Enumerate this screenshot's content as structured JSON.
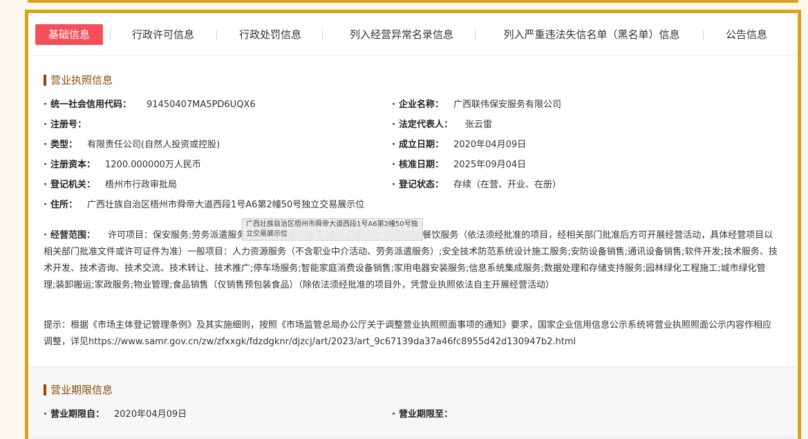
{
  "tabs": [
    {
      "label": "基础信息",
      "active": true
    },
    {
      "label": "行政许可信息"
    },
    {
      "label": "行政处罚信息"
    },
    {
      "label": "列入经营异常名录信息"
    },
    {
      "label": "列入严重违法失信名单（黑名单）信息"
    },
    {
      "label": "公告信息"
    }
  ],
  "license": {
    "title": "营业执照信息",
    "credit_code_label": "统一社会信用代码：",
    "credit_code": "91450407MA5PD6UQX6",
    "company_name_label": "企业名称：",
    "company_name": "广西联伟保安服务有限公司",
    "reg_no_label": "注册号：",
    "reg_no": "",
    "legal_rep_label": "法定代表人：",
    "legal_rep": "张云雷",
    "type_label": "类型：",
    "type": "有限责任公司(自然人投资或控股)",
    "est_date_label": "成立日期：",
    "est_date": "2020年04月09日",
    "capital_label": "注册资本：",
    "capital": "1200.000000万人民币",
    "approve_date_label": "核准日期：",
    "approve_date": "2025年09月04日",
    "authority_label": "登记机关：",
    "authority": "梧州市行政审批局",
    "status_label": "登记状态：",
    "status": "存续（在营、开业、在册）",
    "address_label": "住所：",
    "address": "广西壮族自治区梧州市舜帝大道西段1号A6第2幢50号独立交易展示位",
    "scope_label": "经营范围：",
    "scope": "许可项目：保安服务;劳务派遣服务;食品经营;餐饮服务;建设工程设计;食品销售;餐饮服务（依法须经批准的项目，经相关部门批准后方可开展经营活动，具体经营项目以相关部门批准文件或许可证件为准）一般项目：人力资源服务（不含职业中介活动、劳务派遣服务）;安全技术防范系统设计施工服务;安防设备销售;通讯设备销售;软件开发;技术服务、技术开发、技术咨询、技术交流、技术转让、技术推广;停车场服务;智能家庭消费设备销售;家用电器安装服务;信息系统集成服务;数据处理和存储支持服务;园林绿化工程施工;城市绿化管理;装卸搬运;家政服务;物业管理;食品销售（仅销售预包装食品）（除依法须经批准的项目外，凭营业执照依法自主开展经营活动）",
    "hint": "提示：根据《市场主体登记管理条例》及其实施细则，按照《市场监管总局办公厅关于调整营业执照照面事项的通知》要求，国家企业信用信息公示系统将营业执照照面公示内容作相应调整，详见https://www.samr.gov.cn/zw/zfxxgk/fdzdgknr/djzcj/art/2023/art_9c67139da37a46fc8955d42d130947b2.html"
  },
  "tooltip": "广西壮族自治区梧州市舜帝大道西段1号A6第2幢50号独立交易展示位",
  "term": {
    "title": "营业期限信息",
    "from_label": "营业期限自：",
    "from": "2020年04月09日",
    "to_label": "营业期限至：",
    "to": ""
  },
  "colors": {
    "border": "#d9a21b",
    "active_tab": "#f5505a",
    "section_title": "#8a4b0b"
  }
}
